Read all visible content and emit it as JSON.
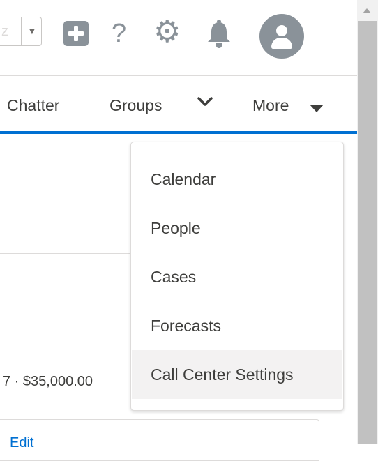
{
  "header": {
    "select_stub_glyph": "z",
    "icons": [
      "plus-box-icon",
      "help-icon",
      "gear-icon",
      "bell-icon",
      "avatar-icon"
    ]
  },
  "nav": {
    "items": [
      {
        "label": "Chatter"
      },
      {
        "label": "Groups"
      },
      {
        "label": "More"
      }
    ],
    "accent_color": "#0070d2"
  },
  "dropdown": {
    "items": [
      {
        "label": "Calendar",
        "active": false
      },
      {
        "label": "People",
        "active": false
      },
      {
        "label": "Cases",
        "active": false
      },
      {
        "label": "Forecasts",
        "active": false
      },
      {
        "label": "Call Center Settings",
        "active": true
      }
    ]
  },
  "page": {
    "amount_text": "7 · $35,000.00",
    "edit_link": "Edit"
  }
}
